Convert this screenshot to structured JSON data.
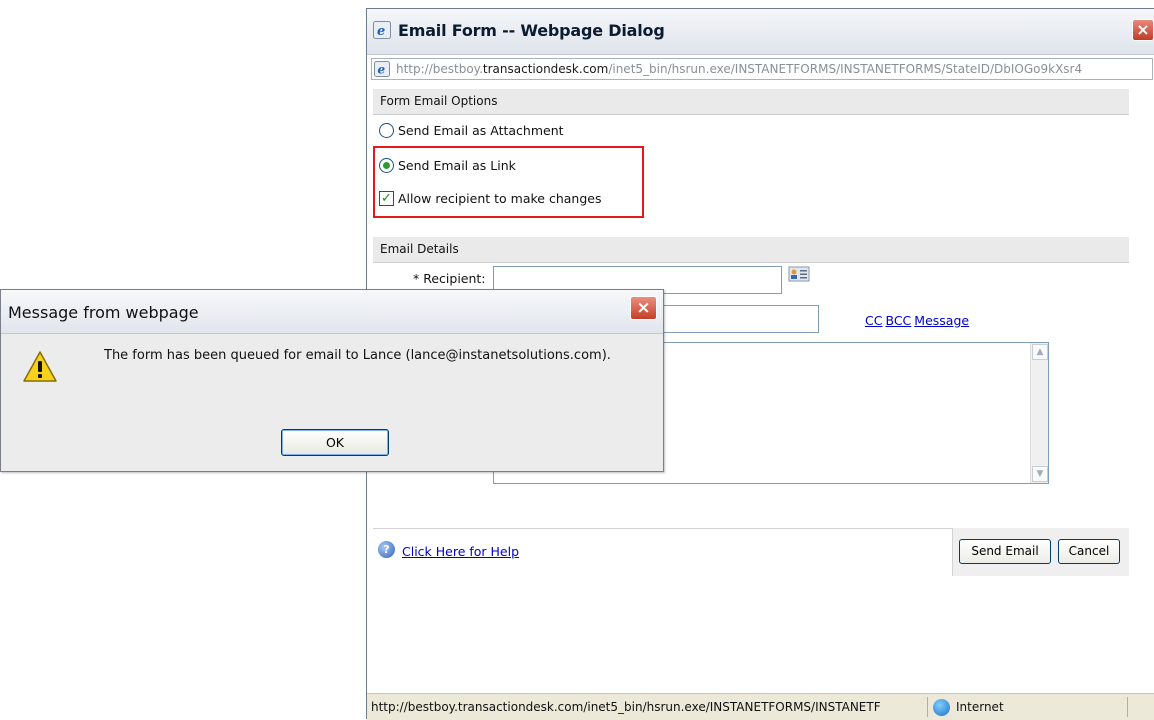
{
  "email_dialog": {
    "title": "Email Form -- Webpage Dialog",
    "close_glyph": "×",
    "address": {
      "prefix": "http://bestboy.",
      "domain": "transactiondesk.com",
      "path": "/inet5_bin/hsrun.exe/INSTANETFORMS/INSTANETFORMS/StateID/DbIOGo9kXsr4"
    },
    "form_email_options": {
      "header": "Form Email Options",
      "attachment_label": "Send Email as Attachment",
      "link_label": "Send Email as Link",
      "allow_changes_label": "Allow recipient to make changes",
      "selected": "Send Email as Link",
      "allow_changes_checked": true
    },
    "email_details": {
      "header": "Email Details",
      "recipient_label": "* Recipient:",
      "recipient_value": "",
      "subject_value": "",
      "links": {
        "cc": "CC",
        "bcc": "BCC",
        "message": "Message"
      },
      "message_value": ""
    },
    "help_link": "Click Here for Help",
    "send_button": "Send Email",
    "cancel_button": "Cancel",
    "status_bar": {
      "url": "http://bestboy.transactiondesk.com/inet5_bin/hsrun.exe/INSTANETFORMS/INSTANETF",
      "zone": "Internet"
    },
    "icons": {
      "page": "ie-page-icon",
      "address_book": "address-book-icon",
      "help": "help-icon",
      "zone": "globe-icon"
    }
  },
  "message_box": {
    "title": "Message from webpage",
    "close_glyph": "×",
    "text": "The form has been queued for email to Lance (lance@instanetsolutions.com).",
    "ok_label": "OK",
    "icon": "warning-icon"
  },
  "colors": {
    "highlight": "#e01b1b",
    "link": "#0000cc",
    "close_button": "#c13b25"
  }
}
